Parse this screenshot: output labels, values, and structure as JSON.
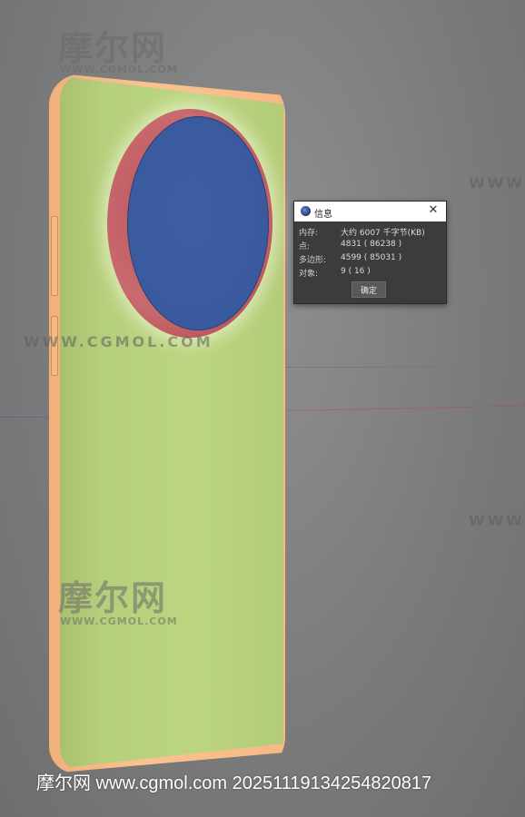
{
  "watermarks": {
    "logo_text": "摩尔网",
    "url_text": "WWW.CGMOL.COM",
    "line_text": "WWW.CGMOL.COM",
    "right_text": "WWW.",
    "footer": "摩尔网 www.cgmol.com 20251119134254820817"
  },
  "info_dialog": {
    "title": "信息",
    "close_icon": "close-icon",
    "rows": [
      {
        "label": "内存:",
        "value": "大约 6007 千字节(KB)"
      },
      {
        "label": "点:",
        "value": "4831 ( 86238 )"
      },
      {
        "label": "多边形:",
        "value": "4599 ( 85031 )"
      },
      {
        "label": "对象:",
        "value": "9 ( 16 )"
      }
    ],
    "ok_label": "确定"
  },
  "colors": {
    "viewport_bg": "#7c7c7c",
    "phone_back": "#b6cf7c",
    "phone_frame": "#f9c291",
    "camera_ring": "#c86a6e",
    "camera_lens": "#3a5aa0"
  }
}
